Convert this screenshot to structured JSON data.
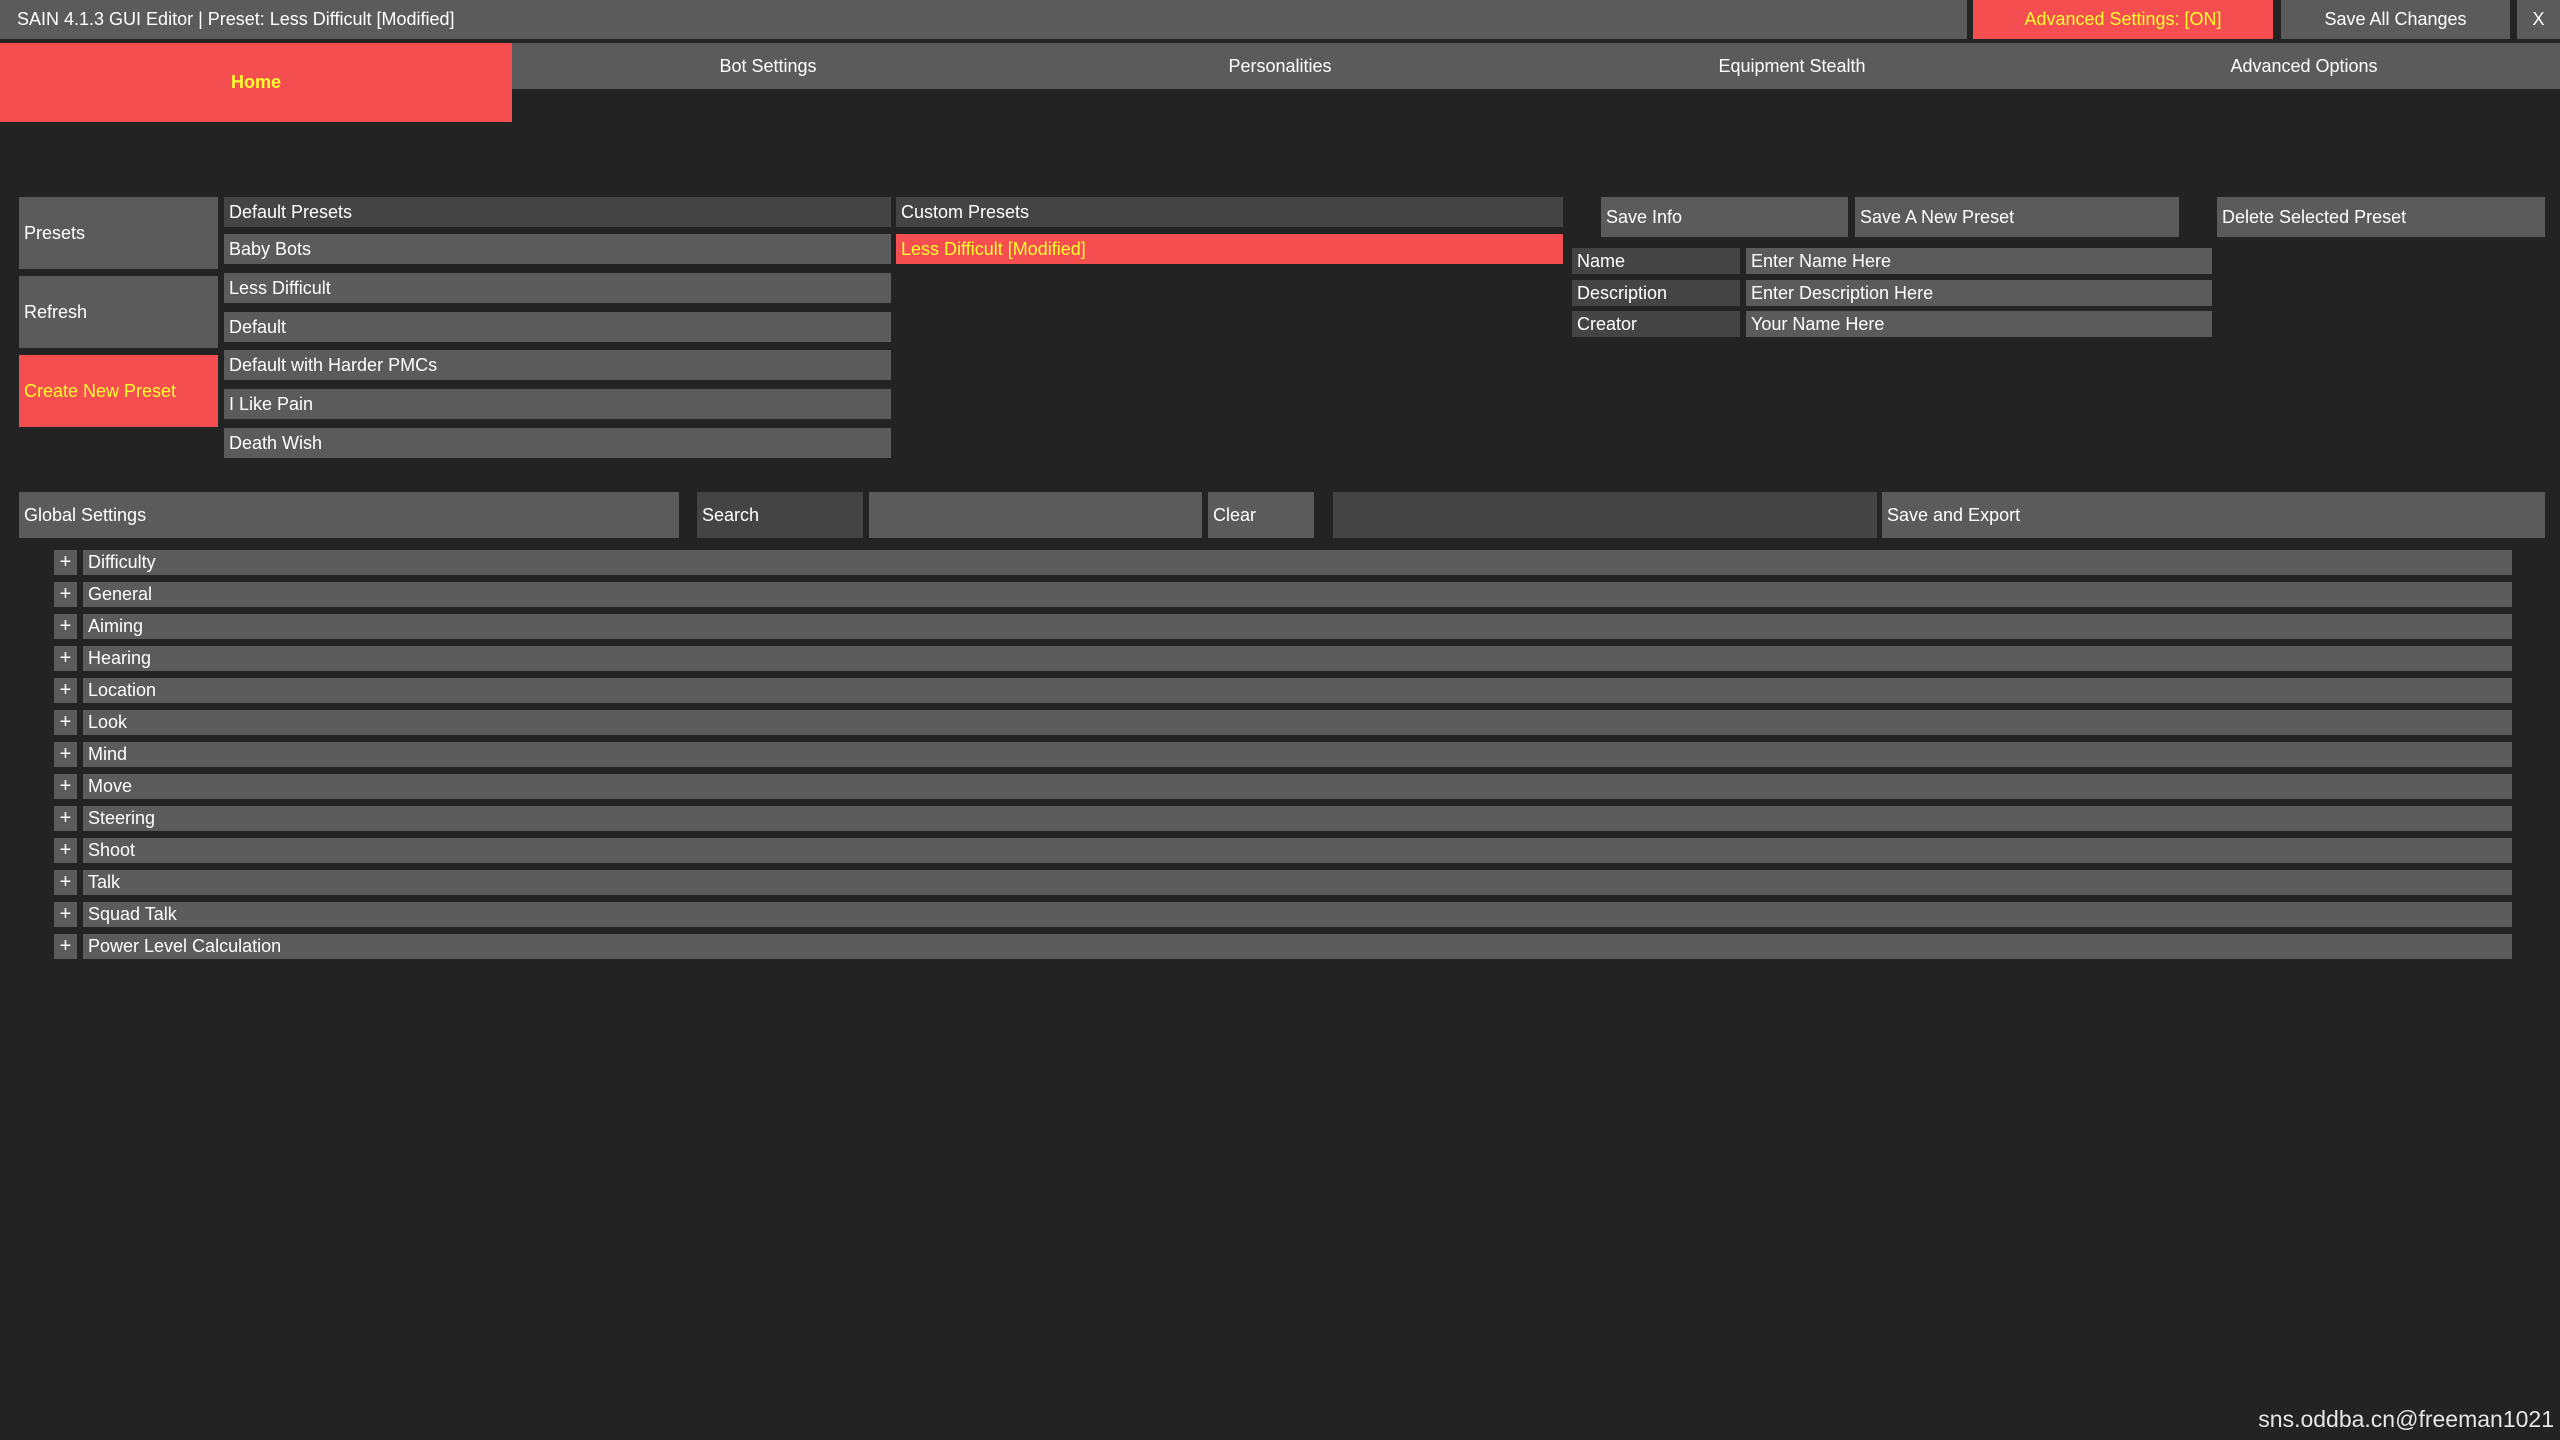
{
  "window": {
    "title": "SAIN 4.1.3 GUI Editor | Preset: Less Difficult [Modified]",
    "advanced_settings_label": "Advanced Settings: [ON]",
    "save_all_label": "Save All Changes",
    "close_label": "X"
  },
  "tabs": [
    {
      "label": "Home"
    },
    {
      "label": "Bot Settings"
    },
    {
      "label": "Personalities"
    },
    {
      "label": "Equipment Stealth"
    },
    {
      "label": "Advanced Options"
    }
  ],
  "presets": {
    "presets_label": "Presets",
    "refresh_label": "Refresh",
    "create_label": "Create New Preset",
    "default_header": "Default Presets",
    "default_items": [
      "Baby Bots",
      "Less Difficult",
      "Default",
      "Default with Harder PMCs",
      "I Like Pain",
      "Death Wish"
    ],
    "custom_header": "Custom Presets",
    "custom_items": [
      "Less Difficult [Modified]"
    ]
  },
  "info": {
    "save_info_label": "Save Info",
    "save_new_label": "Save A New Preset",
    "delete_label": "Delete Selected Preset",
    "fields": [
      {
        "label": "Name",
        "value": "Enter Name Here"
      },
      {
        "label": "Description",
        "value": "Enter Description Here"
      },
      {
        "label": "Creator",
        "value": "Your Name Here"
      }
    ]
  },
  "global": {
    "title": "Global Settings",
    "search_label": "Search",
    "search_value": "",
    "clear_label": "Clear",
    "export_label": "Save and Export",
    "sections": [
      "Difficulty",
      "General",
      "Aiming",
      "Hearing",
      "Location",
      "Look",
      "Mind",
      "Move",
      "Steering",
      "Shoot",
      "Talk",
      "Squad Talk",
      "Power Level Calculation"
    ],
    "expand_symbol": "+"
  },
  "watermark": "sns.oddba.cn@freeman1021",
  "colors": {
    "accent": "#f44e50",
    "highlight_text": "#fffe2f",
    "button": "#5b5b5b",
    "background": "#232323"
  }
}
